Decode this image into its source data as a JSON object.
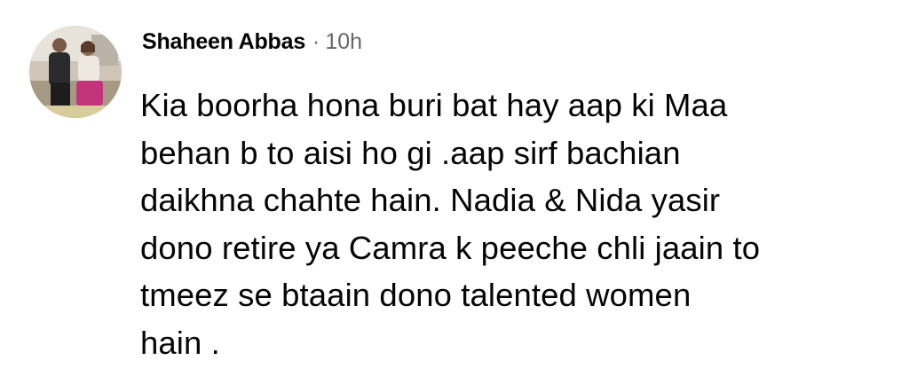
{
  "comment": {
    "author": "Shaheen Abbas",
    "separator": "·",
    "timestamp": "10h",
    "lines": [
      "Kia boorha hona buri bat hay aap ki Maa",
      "behan b to aisi ho gi .aap sirf bachian",
      "daikhna chahte hain. Nadia & Nida yasir",
      "dono retire ya Camra k peeche chli jaain to",
      "tmeez se btaain dono talented women",
      "hain ."
    ]
  },
  "colors": {
    "text": "#050505",
    "meta": "#65676b",
    "background": "#ffffff"
  }
}
